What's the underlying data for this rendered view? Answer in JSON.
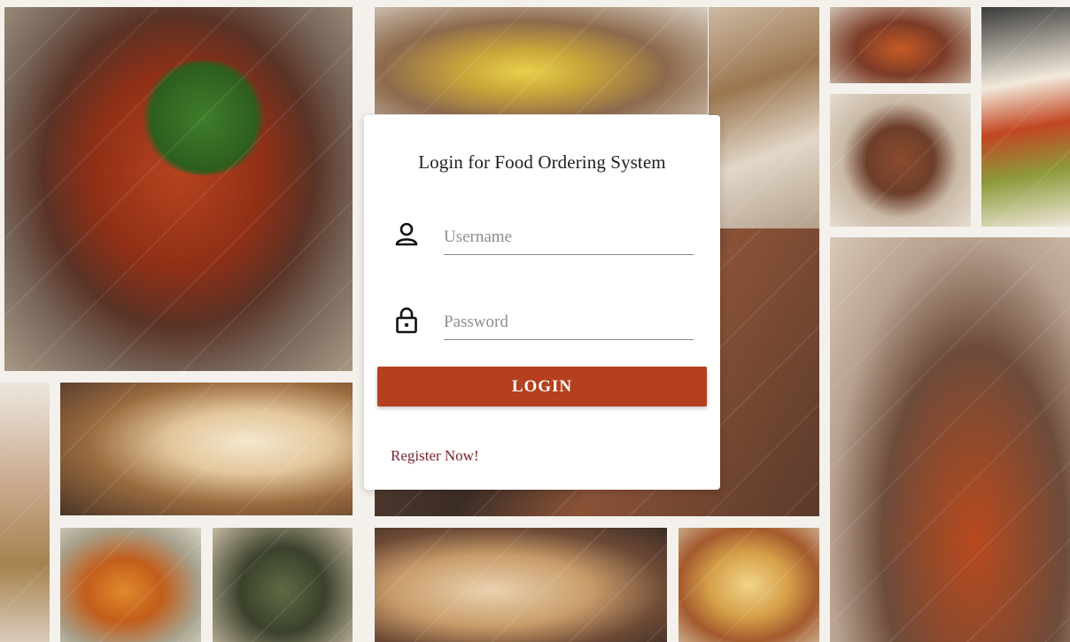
{
  "login": {
    "title": "Login for Food Ordering System",
    "username_placeholder": "Username",
    "password_placeholder": "Password",
    "login_button": "LOGIN",
    "register_link": "Register Now!"
  },
  "colors": {
    "accent": "#b5401f",
    "link": "#7a1f2b"
  },
  "icons": {
    "username": "user-icon",
    "password": "lock-icon"
  }
}
